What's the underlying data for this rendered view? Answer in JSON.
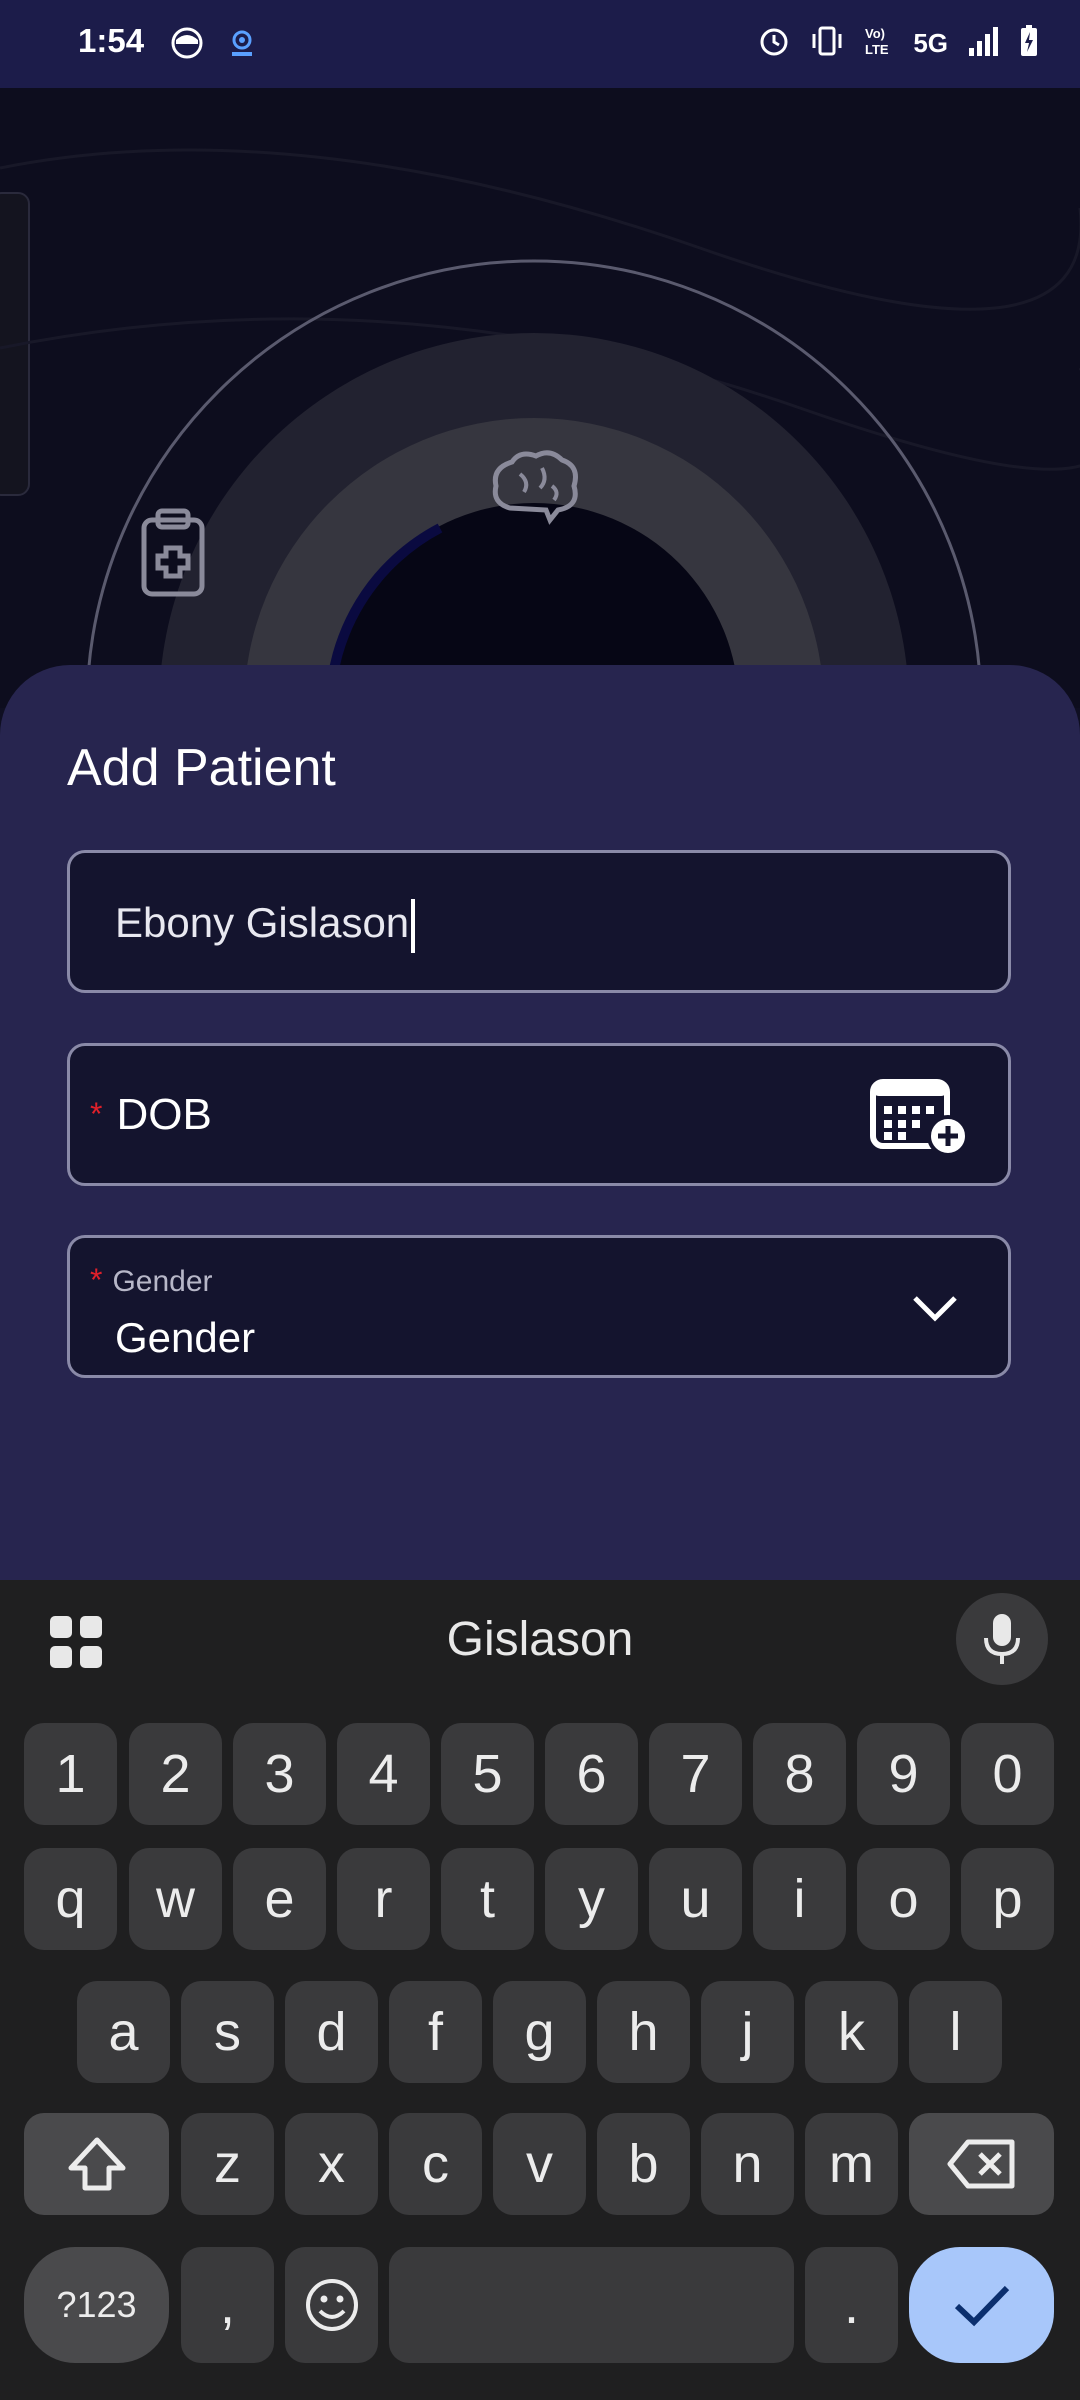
{
  "status_bar": {
    "time": "1:54",
    "network": "5G",
    "icons_left": [
      "app-face-icon",
      "cast-icon"
    ],
    "icons_right": [
      "alarm-icon",
      "vibrate-icon",
      "volte-icon",
      "signal-icon",
      "battery-charging-icon"
    ]
  },
  "background": {
    "icons": [
      "clipboard-medical-icon",
      "brain-icon"
    ]
  },
  "sheet": {
    "title": "Add Patient",
    "name_field": {
      "value": "Ebony Gislason"
    },
    "dob_field": {
      "required_mark": "*",
      "label": "DOB"
    },
    "gender_field": {
      "required_mark": "*",
      "label": "Gender",
      "value": "Gender"
    }
  },
  "keyboard": {
    "suggestion": "Gislason",
    "row_numbers": [
      "1",
      "2",
      "3",
      "4",
      "5",
      "6",
      "7",
      "8",
      "9",
      "0"
    ],
    "row_q": [
      "q",
      "w",
      "e",
      "r",
      "t",
      "y",
      "u",
      "i",
      "o",
      "p"
    ],
    "row_a": [
      "a",
      "s",
      "d",
      "f",
      "g",
      "h",
      "j",
      "k",
      "l"
    ],
    "row_z": [
      "z",
      "x",
      "c",
      "v",
      "b",
      "n",
      "m"
    ],
    "symbols_label": "?123",
    "comma_label": ",",
    "period_label": "."
  },
  "colors": {
    "sheet_bg": "#27254f",
    "field_bg": "#14142e",
    "required": "#e0202a",
    "keyboard_bg": "#1f1f20",
    "key_bg": "#3a3a3c",
    "enter_key": "#a8c7fa"
  }
}
